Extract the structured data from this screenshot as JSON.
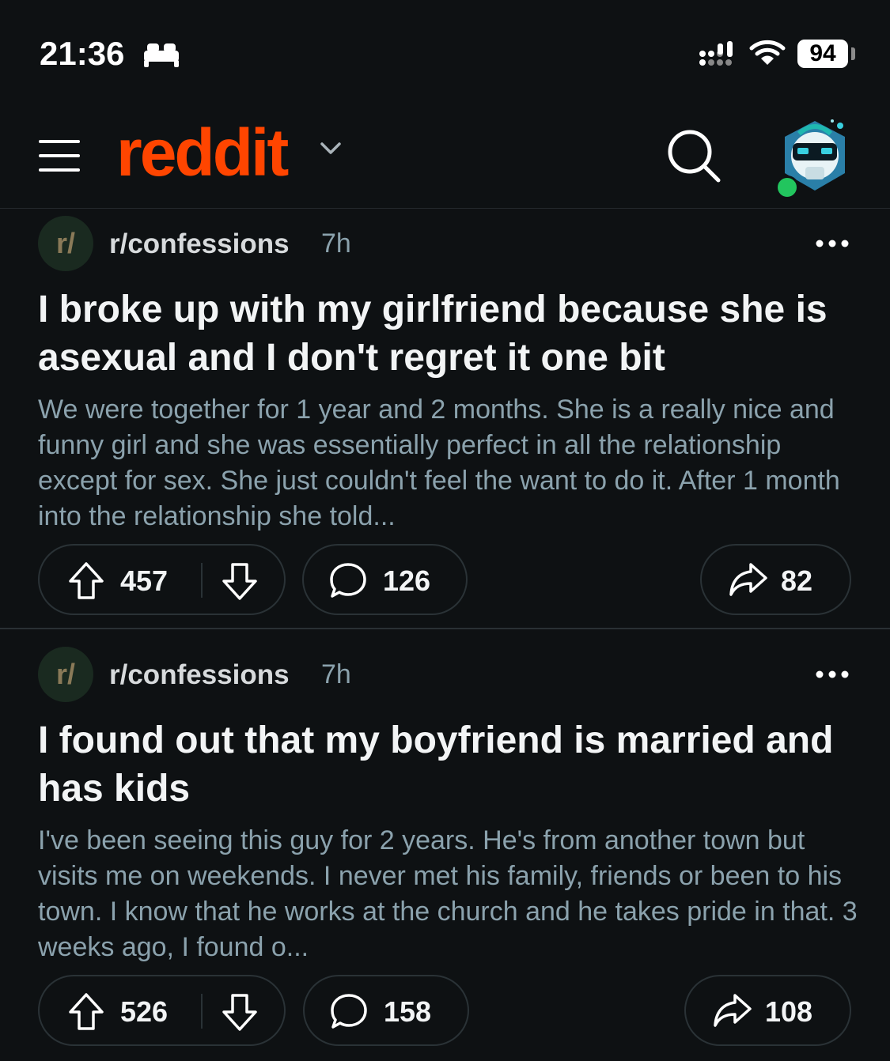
{
  "status_bar": {
    "time": "21:36",
    "battery": "94"
  },
  "header": {
    "logo": "reddit"
  },
  "posts": [
    {
      "subreddit_avatar": "r/",
      "subreddit": "r/confessions",
      "age": "7h",
      "title": "I broke up with my girlfriend because she is asexual and I don't regret it one bit",
      "body": "We were together for 1 year and 2 months. She is a really nice and funny girl and she was essentially perfect in all the relationship except for sex. She just couldn't feel the want to do it. After 1 month into the relationship she told...",
      "votes": "457",
      "comments": "126",
      "shares": "82"
    },
    {
      "subreddit_avatar": "r/",
      "subreddit": "r/confessions",
      "age": "7h",
      "title": "I found out that my boyfriend is married and has kids",
      "body": "I've been seeing this guy for 2 years. He's from another town but visits me on weekends. I never met his family, friends or been to his town. I know that he works at the church and he takes pride in that. 3 weeks ago, I found o...",
      "votes": "526",
      "comments": "158",
      "shares": "108"
    }
  ],
  "colors": {
    "brand": "#ff4500",
    "background": "#0e1113",
    "online": "#22c55e"
  },
  "icons": [
    "bed-icon",
    "signal-icon",
    "wifi-icon",
    "menu-icon",
    "chevron-down-icon",
    "search-icon",
    "avatar",
    "more-icon",
    "upvote-icon",
    "downvote-icon",
    "comment-icon",
    "share-icon"
  ]
}
